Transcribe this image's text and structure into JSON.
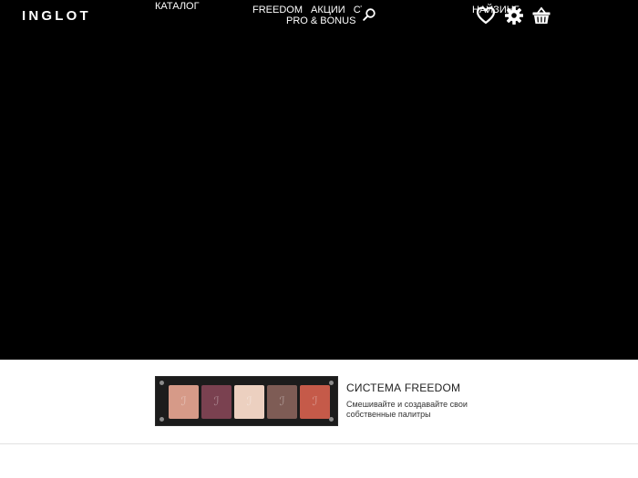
{
  "header": {
    "logo": "INGLOT",
    "catalog_label": "КАТАЛОГ",
    "nav_row1": [
      "FREEDOM",
      "АКЦИИ",
      "СТ"
    ],
    "nav_row2": "PRO & BONUS",
    "lang_label": "НАЙЗИНГ"
  },
  "icons": {
    "search": "search-icon",
    "wishlist": "heart-icon",
    "settings": "gear-icon",
    "cart": "basket-icon"
  },
  "promo": {
    "title": "СИСТЕМА FREEDOM",
    "description": "Смешивайте и создавайте свои собственные палитры",
    "pan_colors": [
      "#d69a88",
      "#7a4150",
      "#ecd0c0",
      "#7e5c55",
      "#c55a49"
    ]
  },
  "colors": {
    "hero_bg": "#000000",
    "page_bg": "#ffffff"
  }
}
